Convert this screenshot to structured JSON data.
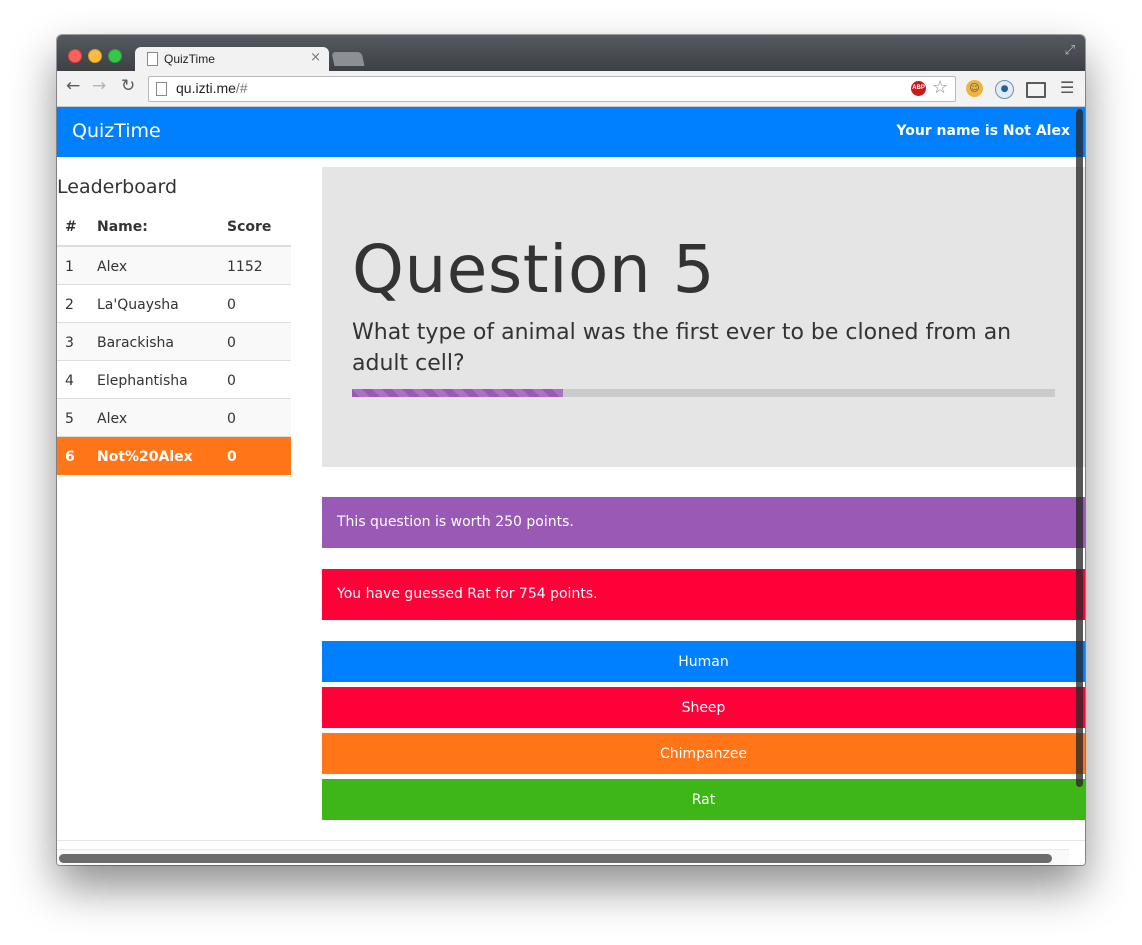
{
  "browser": {
    "tab_title": "QuizTime",
    "tab_close": "×",
    "url_host": "qu.izti.me",
    "url_path": "/#",
    "abp_label": "ABP",
    "icons": [
      "back-arrow-icon",
      "forward-arrow-icon",
      "reload-icon",
      "page-icon",
      "adblock-icon",
      "bookmark-star-icon",
      "extension-icon",
      "chat-extension-icon",
      "cast-icon",
      "menu-icon"
    ]
  },
  "navbar": {
    "brand": "QuizTime",
    "user": "Your name is Not Alex",
    "color": "#007fff"
  },
  "leaderboard": {
    "title": "Leaderboard",
    "headers": {
      "rank": "#",
      "name": "Name:",
      "score": "Score"
    },
    "rows": [
      {
        "rank": "1",
        "name": "Alex",
        "score": "1152"
      },
      {
        "rank": "2",
        "name": "La'Quaysha",
        "score": "0"
      },
      {
        "rank": "3",
        "name": "Barackisha",
        "score": "0"
      },
      {
        "rank": "4",
        "name": "Elephantisha",
        "score": "0"
      },
      {
        "rank": "5",
        "name": "Alex",
        "score": "0"
      },
      {
        "rank": "6",
        "name": "Not%20Alex",
        "score": "0"
      }
    ],
    "current_row_color": "#ff7518"
  },
  "question": {
    "title": "Question 5",
    "text": "What type of animal was the first ever to be cloned from an adult cell?",
    "progress_percent": 30,
    "progress_color": "#9b59b6"
  },
  "alerts": {
    "worth": "This question is worth 250 points.",
    "guess": "You have guessed Rat for 754 points."
  },
  "answers": [
    {
      "label": "Human",
      "color": "#007fff"
    },
    {
      "label": "Sheep",
      "color": "#ff0039"
    },
    {
      "label": "Chimpanzee",
      "color": "#ff7518"
    },
    {
      "label": "Rat",
      "color": "#3fb618"
    }
  ]
}
